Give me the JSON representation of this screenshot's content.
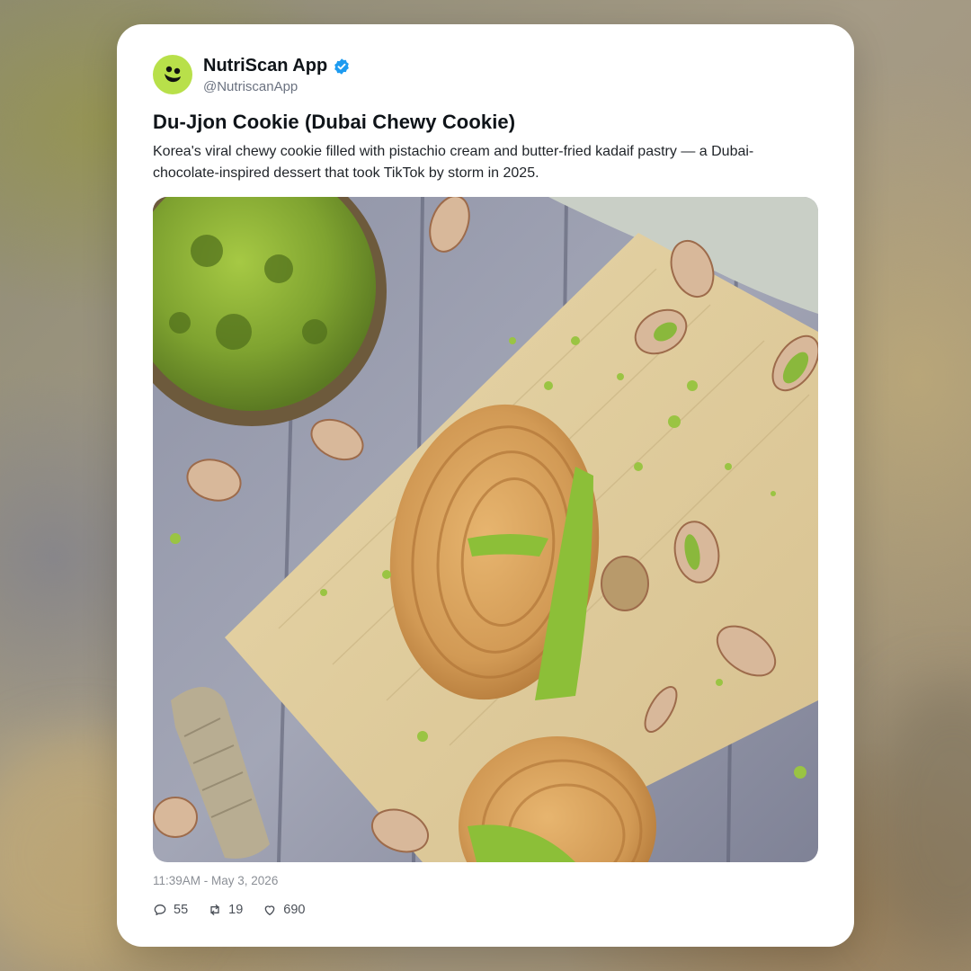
{
  "post": {
    "author_name": "NutriScan App",
    "author_handle": "@NutriscanApp",
    "title": "Du-Jjon Cookie (Dubai Chewy Cookie)",
    "description": "Korea's viral chewy cookie filled with pistachio cream and butter-fried kadaif pastry — a Dubai-chocolate-inspired dessert that took TikTok by storm in 2025.",
    "timestamp": "11:39AM - May 3, 2026",
    "stats": {
      "replies": "55",
      "reposts": "19",
      "likes": "690"
    }
  },
  "icons": {
    "avatar": "nutriscan-logo-icon",
    "verified": "verified-badge-icon",
    "reply": "reply-icon",
    "repost": "repost-icon",
    "like": "heart-icon"
  },
  "colors": {
    "verified": "#1d9bf0",
    "avatar_bg": "#b8e04a"
  }
}
